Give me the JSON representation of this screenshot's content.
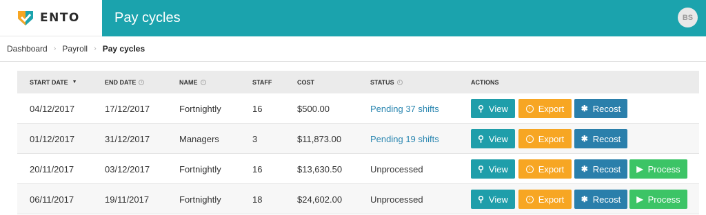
{
  "brand": {
    "name": "ENTO"
  },
  "header": {
    "title": "Pay cycles",
    "avatar_initials": "BS"
  },
  "breadcrumb": [
    {
      "label": "Dashboard"
    },
    {
      "label": "Payroll"
    },
    {
      "label": "Pay cycles"
    }
  ],
  "table": {
    "headers": {
      "start_date": "START DATE",
      "end_date": "END DATE",
      "name": "NAME",
      "staff": "STAFF",
      "cost": "COST",
      "status": "STATUS",
      "actions": "ACTIONS"
    },
    "sort_indicator": "▼",
    "info_symbol": "i",
    "rows": [
      {
        "start_date": "04/12/2017",
        "end_date": "17/12/2017",
        "name": "Fortnightly",
        "staff": "16",
        "cost": "$500.00",
        "status": "Pending 37 shifts",
        "status_is_link": true
      },
      {
        "start_date": "01/12/2017",
        "end_date": "31/12/2017",
        "name": "Managers",
        "staff": "3",
        "cost": "$11,873.00",
        "status": "Pending 19 shifts",
        "status_is_link": true
      },
      {
        "start_date": "20/11/2017",
        "end_date": "03/12/2017",
        "name": "Fortnightly",
        "staff": "16",
        "cost": "$13,630.50",
        "status": "Unprocessed",
        "status_is_link": false
      },
      {
        "start_date": "06/11/2017",
        "end_date": "19/11/2017",
        "name": "Fortnightly",
        "staff": "18",
        "cost": "$24,602.00",
        "status": "Unprocessed",
        "status_is_link": false
      }
    ]
  },
  "actions": {
    "view_label": "View",
    "export_label": "Export",
    "recost_label": "Recost",
    "process_label": "Process"
  },
  "colors": {
    "header_bg": "#1ba3ad",
    "view": "#1f9eaa",
    "export": "#f7a623",
    "recost": "#2a7fab",
    "process": "#3cc466",
    "link": "#2a86b0"
  },
  "icons": {
    "view": "search-icon",
    "export": "download-circle-icon",
    "recost": "gear-icon",
    "process": "play-icon"
  }
}
